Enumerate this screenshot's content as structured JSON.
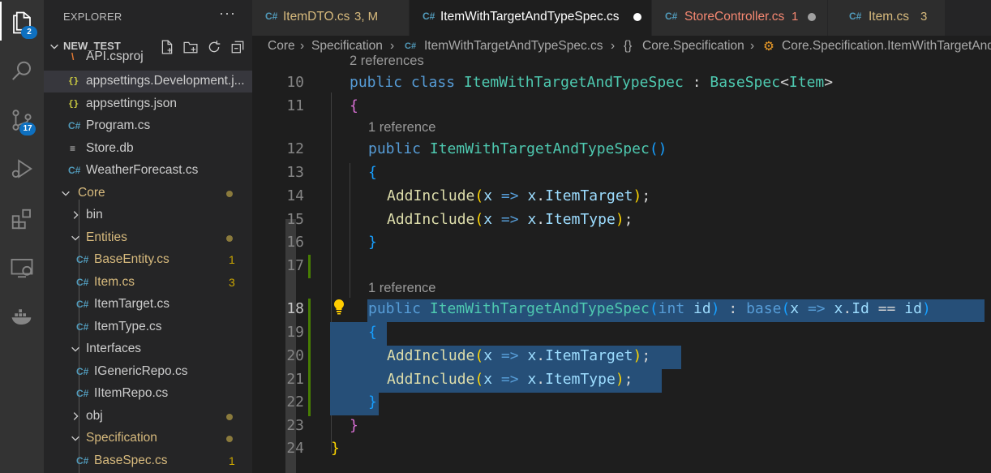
{
  "activity_bar": {
    "explorer_badge": "2",
    "scm_badge": "17",
    "icons": [
      "files-icon",
      "search-icon",
      "source-control-icon",
      "run-debug-icon",
      "extensions-icon",
      "remote-explorer-icon",
      "docker-icon"
    ]
  },
  "sidebar": {
    "title": "EXPLORER",
    "more": "···",
    "project": "NEW_TEST",
    "items": [
      {
        "label": "API.csproj",
        "icon": "rss-icon"
      },
      {
        "label": "appsettings.Development.j...",
        "icon": "json-icon"
      },
      {
        "label": "appsettings.json",
        "icon": "json-icon"
      },
      {
        "label": "Program.cs",
        "icon": "csharp-icon"
      },
      {
        "label": "Store.db",
        "icon": "database-icon"
      },
      {
        "label": "WeatherForecast.cs",
        "icon": "csharp-icon"
      },
      {
        "label": "Core",
        "icon": "chevron-down-icon"
      },
      {
        "label": "bin",
        "icon": "chevron-right-icon"
      },
      {
        "label": "Entities",
        "icon": "chevron-down-icon"
      },
      {
        "label": "BaseEntity.cs",
        "icon": "csharp-icon",
        "count": "1"
      },
      {
        "label": "Item.cs",
        "icon": "csharp-icon",
        "count": "3"
      },
      {
        "label": "ItemTarget.cs",
        "icon": "csharp-icon"
      },
      {
        "label": "ItemType.cs",
        "icon": "csharp-icon"
      },
      {
        "label": "Interfaces",
        "icon": "chevron-down-icon"
      },
      {
        "label": "IGenericRepo.cs",
        "icon": "csharp-icon"
      },
      {
        "label": "IItemRepo.cs",
        "icon": "csharp-icon"
      },
      {
        "label": "obj",
        "icon": "chevron-right-icon"
      },
      {
        "label": "Specification",
        "icon": "chevron-down-icon"
      },
      {
        "label": "BaseSpec.cs",
        "icon": "csharp-icon",
        "count": "1"
      }
    ]
  },
  "tabs": [
    {
      "label": "ItemDTO.cs",
      "extra": "3, M",
      "color": "#d7ba7d"
    },
    {
      "label": "ItemWithTargetAndTypeSpec.cs",
      "extra": "",
      "color": "#ffffff",
      "active": true
    },
    {
      "label": "StoreController.cs",
      "extra": "1",
      "color": "#f48771"
    },
    {
      "label": "Item.cs",
      "extra": "3",
      "color": "#d7ba7d"
    }
  ],
  "breadcrumb": {
    "root": "Core",
    "folder": "Specification",
    "file": "ItemWithTargetAndTypeSpec.cs",
    "namespace": "Core.Specification",
    "class": "Core.Specification.ItemWithTargetAndTypeSpec"
  },
  "editor": {
    "codelens": {
      "refs2": "2 references",
      "refs1a": "1 reference",
      "refs1b": "1 reference"
    },
    "line_numbers": [
      "10",
      "11",
      "12",
      "13",
      "14",
      "15",
      "16",
      "17",
      "18",
      "19",
      "20",
      "21",
      "22",
      "23",
      "24"
    ]
  }
}
